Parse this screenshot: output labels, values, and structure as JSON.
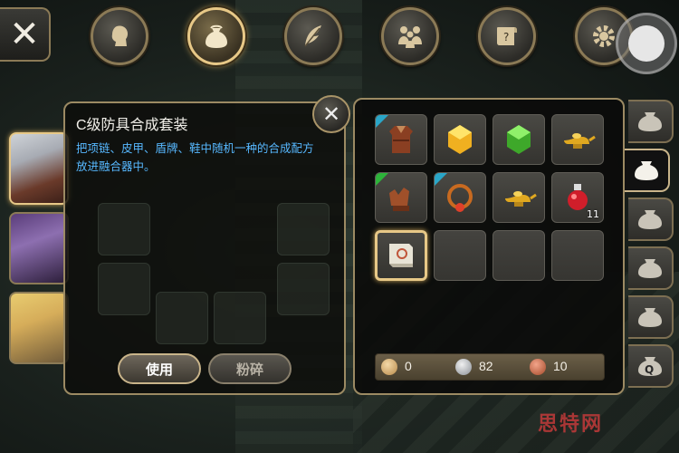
{
  "nav": {
    "tabs": [
      {
        "name": "character"
      },
      {
        "name": "bag",
        "active": true
      },
      {
        "name": "skills"
      },
      {
        "name": "party"
      },
      {
        "name": "quests"
      },
      {
        "name": "settings"
      }
    ]
  },
  "item_detail": {
    "title": "C级防具合成套装",
    "description": "把项链、皮甲、盾牌、鞋中随机一种的合成配方放进融合器中。",
    "use_label": "使用",
    "smash_label": "粉碎"
  },
  "inventory": {
    "items": [
      {
        "icon": "leather-armor-icon",
        "corner": "#2aa6c8"
      },
      {
        "icon": "yellow-gem-icon"
      },
      {
        "icon": "green-gem-icon"
      },
      {
        "icon": "magic-lamp-icon"
      },
      {
        "icon": "gloves-icon",
        "corner": "#2db43a"
      },
      {
        "icon": "necklace-icon",
        "corner": "#2aa6c8"
      },
      {
        "icon": "magic-lamp-icon"
      },
      {
        "icon": "red-potion-icon",
        "count": "11"
      },
      {
        "icon": "scroll-icon",
        "selected": true
      },
      {
        "icon": "empty"
      },
      {
        "icon": "empty"
      },
      {
        "icon": "empty"
      }
    ]
  },
  "currency": {
    "gold": "0",
    "silver": "82",
    "copper": "10"
  },
  "side_tabs": [
    {
      "icon": "bag-icon"
    },
    {
      "icon": "bag-icon",
      "active": true
    },
    {
      "icon": "bag-icon"
    },
    {
      "icon": "bag-icon"
    },
    {
      "icon": "bag-icon"
    },
    {
      "icon": "quest-bag-icon",
      "label": "Q"
    }
  ],
  "watermark": "思特网"
}
